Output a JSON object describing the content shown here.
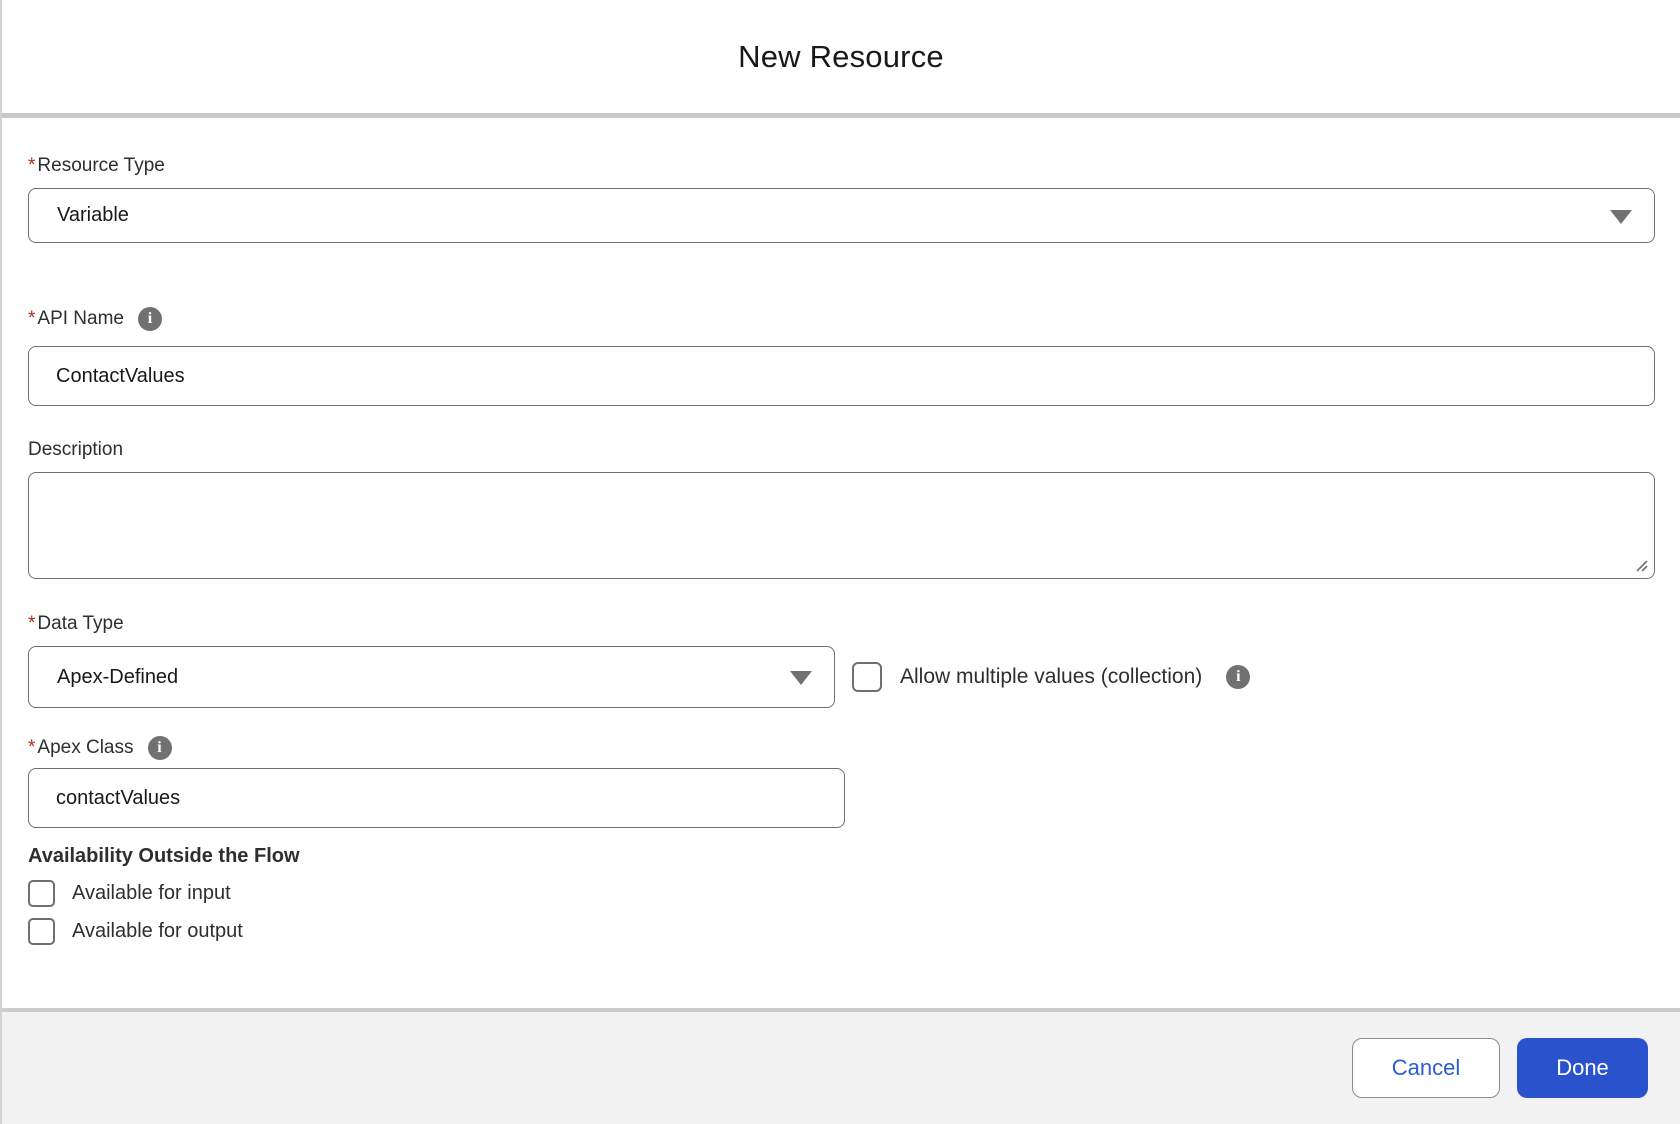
{
  "header": {
    "title": "New Resource"
  },
  "ui": {
    "required_marker": "*"
  },
  "colors": {
    "brand_blue": "#2952cc",
    "link_blue": "#2b5cd1",
    "required_red": "#b42b1f",
    "border_gray": "#6f6f6f"
  },
  "icons": {
    "info_glyph": "i",
    "chevron_down": "triangle-down",
    "resize_handle": "diagonal-grip"
  },
  "form": {
    "resource_type": {
      "label": "Resource Type",
      "required": true,
      "value": "Variable"
    },
    "api_name": {
      "label": "API Name",
      "required": true,
      "value": "ContactValues"
    },
    "description": {
      "label": "Description",
      "value": ""
    },
    "data_type": {
      "label": "Data Type",
      "required": true,
      "value": "Apex-Defined"
    },
    "allow_multiple": {
      "label": "Allow multiple values (collection)",
      "checked": false
    },
    "apex_class": {
      "label": "Apex Class",
      "required": true,
      "value": "contactValues"
    },
    "availability": {
      "heading": "Availability Outside the Flow",
      "options": [
        {
          "label": "Available for input",
          "checked": false
        },
        {
          "label": "Available for output",
          "checked": false
        }
      ]
    }
  },
  "footer": {
    "cancel_label": "Cancel",
    "done_label": "Done"
  }
}
